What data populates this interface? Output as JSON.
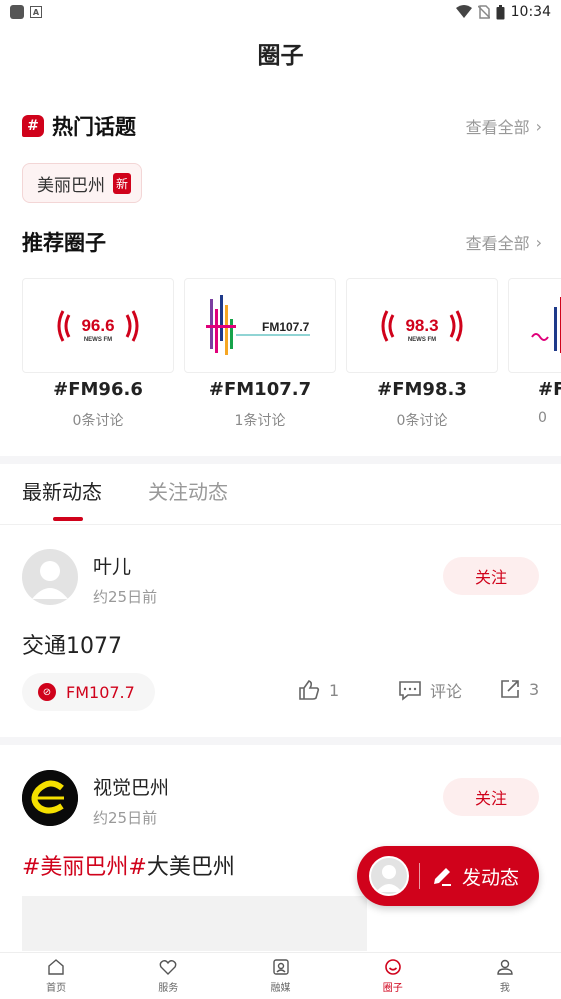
{
  "status_bar": {
    "time": "10:34"
  },
  "header": {
    "title": "圈子"
  },
  "hot_topics": {
    "title": "热门话题",
    "badge": "#",
    "see_all": "查看全部",
    "chips": [
      {
        "label": "美丽巴州",
        "tag": "新"
      }
    ]
  },
  "recommended": {
    "title": "推荐圈子",
    "see_all": "查看全部",
    "circles": [
      {
        "logo_text": "96.6",
        "logo_sub": "NEWS FM",
        "name": "#FM96.6",
        "count": "0条讨论"
      },
      {
        "logo_text": "FM107.7",
        "name": "#FM107.7",
        "count": "1条讨论"
      },
      {
        "logo_text": "98.3",
        "logo_sub": "NEWS FM",
        "name": "#FM98.3",
        "count": "0条讨论"
      },
      {
        "name": "#F",
        "count": "0"
      }
    ]
  },
  "tabs": [
    {
      "label": "最新动态",
      "active": true
    },
    {
      "label": "关注动态",
      "active": false
    }
  ],
  "posts": [
    {
      "author": "叶儿",
      "time": "约25日前",
      "follow": "关注",
      "text": "交通1077",
      "circle_tag": "FM107.7",
      "likes": "1",
      "comment_label": "评论",
      "shares": "3"
    },
    {
      "author": "视觉巴州",
      "time": "约25日前",
      "follow": "关注",
      "text_tag1": "#美丽巴州#",
      "text_rest": "大美巴州"
    }
  ],
  "fab": {
    "label": "发动态"
  },
  "bottom_nav": [
    {
      "label": "首页",
      "icon": "home-icon"
    },
    {
      "label": "服务",
      "icon": "heart-icon"
    },
    {
      "label": "融媒",
      "icon": "media-icon"
    },
    {
      "label": "圈子",
      "icon": "circle-smile-icon",
      "active": true
    },
    {
      "label": "我",
      "icon": "user-icon"
    }
  ],
  "colors": {
    "accent": "#d0021b"
  }
}
